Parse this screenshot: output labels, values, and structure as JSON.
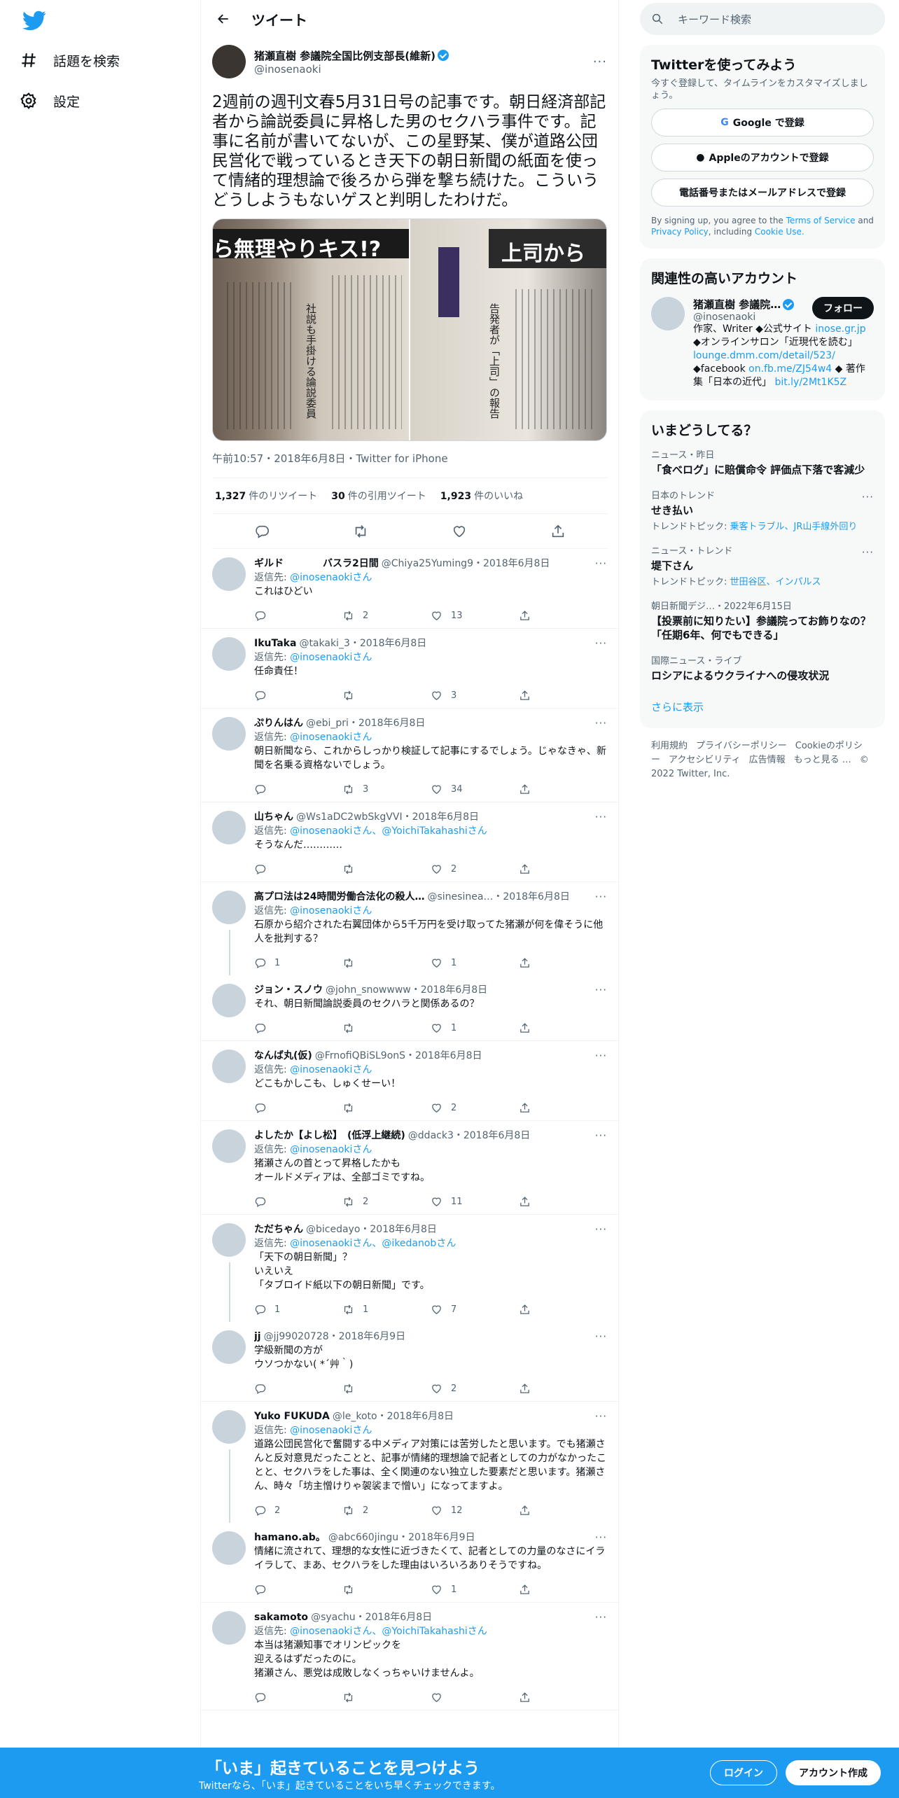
{
  "nav": {
    "explore_label": "話題を検索",
    "settings_label": "設定"
  },
  "header": {
    "title": "ツイート"
  },
  "tweet": {
    "name": "猪瀬直樹 参議院全国比例支部長(維新)",
    "handle": "@inosenaoki",
    "text": "2週前の週刊文春5月31日号の記事です。朝日経済部記者から論説委員に昇格した男のセクハラ事件です。記事に名前が書いてないが、この星野某、僕が道路公団民営化で戦っているとき天下の朝日新聞の紙面を使って情緒的理想論で後ろから弾を撃ち続けた。こういうどうしようもないゲスと判明したわけだ。",
    "media_left_headline": "ら無理やりキス!?",
    "media_left_caption": "社説も手掛ける論説委員",
    "media_right_headline": "上司から",
    "media_right_caption": "告発者が「上司」の報告",
    "meta": "午前10:57・2018年6月8日・Twitter for iPhone",
    "retweets": "1,327",
    "retweets_label": "件のリツイート",
    "quotes": "30",
    "quotes_label": "件の引用ツイート",
    "likes": "1,923",
    "likes_label": "件のいいね"
  },
  "replies": [
    {
      "name": "ギルド　　　　バスラ2日間",
      "handle": "@Chiya25Yuming9・2018年6月8日",
      "to": "@inosenaokiさん",
      "text": "これはひどい",
      "reply_count": "",
      "rt_count": "2",
      "like_count": "13"
    },
    {
      "name": "IkuTaka",
      "handle": "@takaki_3・2018年6月8日",
      "to": "@inosenaokiさん",
      "text": "任命責任！",
      "reply_count": "",
      "rt_count": "",
      "like_count": "3"
    },
    {
      "name": "ぷりんはん",
      "handle": "@ebi_pri・2018年6月8日",
      "to": "@inosenaokiさん",
      "text": "朝日新聞なら、これからしっかり検証して記事にするでしょう。じゃなきゃ、新聞を名乗る資格ないでしょう。",
      "reply_count": "",
      "rt_count": "3",
      "like_count": "34"
    },
    {
      "name": "山ちゃん",
      "handle": "@Ws1aDC2wbSkgVVI・2018年6月8日",
      "to": "@inosenaokiさん、@YoichiTakahashiさん",
      "text": "そうなんだ…………",
      "reply_count": "",
      "rt_count": "",
      "like_count": "2"
    },
    {
      "name": "高プロ法は24時間労働合法化の殺人…",
      "handle": "@sinesinea…・2018年6月8日",
      "to": "@inosenaokiさん",
      "text": "石原から紹介された右翼団体から5千万円を受け取ってた猪瀬が何を偉そうに他人を批判する？",
      "reply_count": "1",
      "rt_count": "",
      "like_count": "1"
    },
    {
      "name": "ジョン・スノウ",
      "handle": "@john_snowwww・2018年6月8日",
      "to": "",
      "text": "それ、朝日新聞論説委員のセクハラと関係あるの？",
      "reply_count": "",
      "rt_count": "",
      "like_count": "1"
    },
    {
      "name": "なんば丸(仮)",
      "handle": "@FrnofiQBiSL9onS・2018年6月8日",
      "to": "@inosenaokiさん",
      "text": "どこもかしこも、しゅくせーい！",
      "reply_count": "",
      "rt_count": "",
      "like_count": "2"
    },
    {
      "name": "よしたか【よし松】　(低浮上継続)",
      "handle": "@ddack3・2018年6月8日",
      "to": "@inosenaokiさん",
      "text": "猪瀬さんの首とって昇格したかも\nオールドメディアは、全部ゴミですね。",
      "reply_count": "",
      "rt_count": "2",
      "like_count": "11"
    },
    {
      "name": "ただちゃん",
      "handle": "@bicedayo・2018年6月8日",
      "to": "@inosenaokiさん、@ikedanobさん",
      "text": "「天下の朝日新聞」？\nいえいえ\n「タブロイド紙以下の朝日新聞」です。",
      "reply_count": "1",
      "rt_count": "1",
      "like_count": "7"
    },
    {
      "name": "jj",
      "handle": "@jj99020728・2018年6月9日",
      "to": "",
      "text": "学級新聞の方が\nウソつかない( *´艸｀)",
      "reply_count": "",
      "rt_count": "",
      "like_count": "2"
    },
    {
      "name": "Yuko FUKUDA",
      "handle": "@le_koto・2018年6月8日",
      "to": "@inosenaokiさん",
      "text": "道路公団民営化で奮闘する中メディア対策には苦労したと思います。でも猪瀬さんと反対意見だったことと、記事が情緒的理想論で記者としての力がなかったことと、セクハラをした事は、全く関連のない独立した要素だと思います。猪瀬さん、時々「坊主憎けりゃ袈裟まで憎い」になってますよ。",
      "reply_count": "2",
      "rt_count": "2",
      "like_count": "12"
    },
    {
      "name": "hamano.ab。",
      "handle": "@abc660jingu・2018年6月9日",
      "to": "",
      "text": "情緒に流されて、理想的な女性に近づきたくて、記者としての力量のなさにイライラして、まあ、セクハラをした理由はいろいろありそうですね。",
      "reply_count": "",
      "rt_count": "",
      "like_count": "1"
    },
    {
      "name": "sakamoto",
      "handle": "@syachu・2018年6月8日",
      "to": "@inosenaokiさん、@YoichiTakahashiさん",
      "text": "本当は猪瀬知事でオリンピックを\n迎えるはずだったのに。\n猪瀬さん、悪党は成敗しなくっちゃいけませんよ。",
      "reply_count": "",
      "rt_count": "",
      "like_count": ""
    }
  ],
  "reply_to_prefix": "返信先: ",
  "sidebar": {
    "search_placeholder": "キーワード検索",
    "signup_title": "Twitterを使ってみよう",
    "signup_sub": "今すぐ登録して、タイムラインをカスタマイズしましょう。",
    "google_btn": "Google で登録",
    "apple_btn": "Appleのアカウントで登録",
    "phone_btn": "電話番号またはメールアドレスで登録",
    "terms_pre": "By signing up, you agree to the ",
    "terms_tos": "Terms of Service",
    "terms_and": " and ",
    "terms_privacy": "Privacy Policy",
    "terms_incl": ", including ",
    "terms_cookie": "Cookie Use.",
    "related_title": "関連性の高いアカウント",
    "related_name": "猪瀬直樹 参議院…",
    "related_handle": "@inosenaoki",
    "follow_btn": "フォロー",
    "related_bio1": "作家、Writer ◆公式サイト ",
    "related_link1": "inose.gr.jp",
    "related_bio2": " ◆オンラインサロン「近現代を読む」",
    "related_link2": "lounge.dmm.com/detail/523/",
    "related_bio3": " ◆facebook ",
    "related_link3": "on.fb.me/ZJ54w4",
    "related_bio4": " ◆ 著作集「日本の近代」 ",
    "related_link4": "bit.ly/2Mt1K5Z",
    "trends_title": "いまどうしてる？",
    "trends": [
      {
        "ctx": "ニュース・昨日",
        "title": "「食べログ」に賠償命令 評価点下落で客減少",
        "topic_label": "",
        "topic": ""
      },
      {
        "ctx": "日本のトレンド",
        "title": "せき払い",
        "topic_label": "トレンドトピック: ",
        "topic": "乗客トラブル、JR山手線外回り"
      },
      {
        "ctx": "ニュース・トレンド",
        "title": "堤下さん",
        "topic_label": "トレンドトピック: ",
        "topic": "世田谷区、インパルス"
      },
      {
        "ctx": "朝日新聞デジ…・2022年6月15日",
        "title": "【投票前に知りたい】参議院ってお飾りなの？　「任期6年、何でもできる」",
        "topic_label": "",
        "topic": ""
      },
      {
        "ctx": "国際ニュース・ライブ",
        "title": "ロシアによるウクライナへの侵攻状況",
        "topic_label": "",
        "topic": ""
      }
    ],
    "show_more": "さらに表示",
    "footer": [
      "利用規約",
      "プライバシーポリシー",
      "Cookieのポリシー",
      "アクセシビリティ",
      "広告情報",
      "もっと見る …",
      "© 2022 Twitter, Inc."
    ]
  },
  "bottom_bar": {
    "headline": "「いま」起きていることを見つけよう",
    "sub": "Twitterなら、「いま」起きていることをいち早くチェックできます。",
    "login": "ログイン",
    "signup": "アカウント作成"
  },
  "colors": {
    "accent": "#1d9bf0",
    "text": "#0f1419",
    "muted": "#536471"
  }
}
